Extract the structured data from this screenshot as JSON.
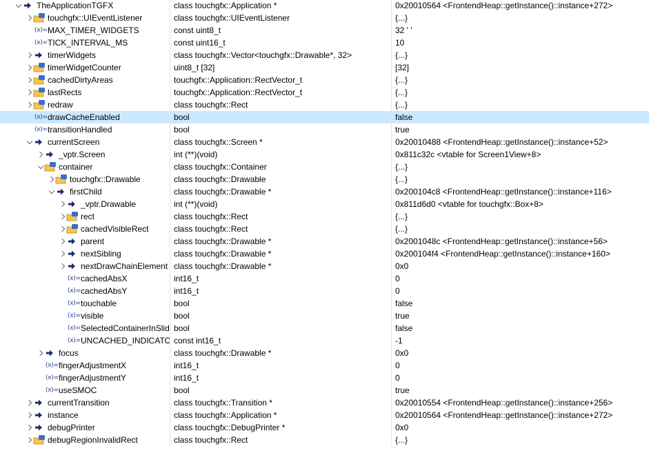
{
  "rows": [
    {
      "name": "TheApplicationTGFX",
      "type": "class touchgfx::Application *",
      "value": "0x20010564 <FrontendHeap::getInstance()::instance+272>",
      "level": 0,
      "toggle": "down",
      "icon": "arrow"
    },
    {
      "name": "touchgfx::UIEventListener",
      "type": "class touchgfx::UIEventListener",
      "value": "{...}",
      "level": 1,
      "toggle": "right",
      "icon": "folder"
    },
    {
      "name": "MAX_TIMER_WIDGETS",
      "type": "const uint8_t",
      "value": "32 ' '",
      "level": 1,
      "toggle": "none",
      "icon": "var"
    },
    {
      "name": "TICK_INTERVAL_MS",
      "type": "const uint16_t",
      "value": "10",
      "level": 1,
      "toggle": "none",
      "icon": "var"
    },
    {
      "name": "timerWidgets",
      "type": "class touchgfx::Vector<touchgfx::Drawable*, 32>",
      "value": "{...}",
      "level": 1,
      "toggle": "right",
      "icon": "arrow"
    },
    {
      "name": "timerWidgetCounter",
      "type": "uint8_t [32]",
      "value": "[32]",
      "level": 1,
      "toggle": "right",
      "icon": "folder"
    },
    {
      "name": "cachedDirtyAreas",
      "type": "touchgfx::Application::RectVector_t",
      "value": "{...}",
      "level": 1,
      "toggle": "right",
      "icon": "folder"
    },
    {
      "name": "lastRects",
      "type": "touchgfx::Application::RectVector_t",
      "value": "{...}",
      "level": 1,
      "toggle": "right",
      "icon": "folder"
    },
    {
      "name": "redraw",
      "type": "class touchgfx::Rect",
      "value": "{...}",
      "level": 1,
      "toggle": "right",
      "icon": "folder"
    },
    {
      "name": "drawCacheEnabled",
      "type": "bool",
      "value": "false",
      "level": 1,
      "toggle": "none",
      "icon": "var",
      "selected": true
    },
    {
      "name": "transitionHandled",
      "type": "bool",
      "value": "true",
      "level": 1,
      "toggle": "none",
      "icon": "var"
    },
    {
      "name": "currentScreen",
      "type": "class touchgfx::Screen *",
      "value": "0x20010488 <FrontendHeap::getInstance()::instance+52>",
      "level": 1,
      "toggle": "down",
      "icon": "arrow"
    },
    {
      "name": "_vptr.Screen",
      "type": "int (**)(void)",
      "value": "0x811c32c <vtable for Screen1View+8>",
      "level": 2,
      "toggle": "right",
      "icon": "arrow"
    },
    {
      "name": "container",
      "type": "class touchgfx::Container",
      "value": "{...}",
      "level": 2,
      "toggle": "down",
      "icon": "folder"
    },
    {
      "name": "touchgfx::Drawable",
      "type": "class touchgfx::Drawable",
      "value": "{...}",
      "level": 3,
      "toggle": "right",
      "icon": "folder"
    },
    {
      "name": "firstChild",
      "type": "class touchgfx::Drawable *",
      "value": "0x200104c8 <FrontendHeap::getInstance()::instance+116>",
      "level": 3,
      "toggle": "down",
      "icon": "arrow"
    },
    {
      "name": "_vptr.Drawable",
      "type": "int (**)(void)",
      "value": "0x811d6d0 <vtable for touchgfx::Box+8>",
      "level": 4,
      "toggle": "right",
      "icon": "arrow"
    },
    {
      "name": "rect",
      "type": "class touchgfx::Rect",
      "value": "{...}",
      "level": 4,
      "toggle": "right",
      "icon": "folder"
    },
    {
      "name": "cachedVisibleRect",
      "type": "class touchgfx::Rect",
      "value": "{...}",
      "level": 4,
      "toggle": "right",
      "icon": "folder"
    },
    {
      "name": "parent",
      "type": "class touchgfx::Drawable *",
      "value": "0x2001048c <FrontendHeap::getInstance()::instance+56>",
      "level": 4,
      "toggle": "right",
      "icon": "arrow"
    },
    {
      "name": "nextSibling",
      "type": "class touchgfx::Drawable *",
      "value": "0x200104f4 <FrontendHeap::getInstance()::instance+160>",
      "level": 4,
      "toggle": "right",
      "icon": "arrow"
    },
    {
      "name": "nextDrawChainElement",
      "type": "class touchgfx::Drawable *",
      "value": "0x0",
      "level": 4,
      "toggle": "right",
      "icon": "arrow"
    },
    {
      "name": "cachedAbsX",
      "type": "int16_t",
      "value": "0",
      "level": 4,
      "toggle": "none",
      "icon": "var"
    },
    {
      "name": "cachedAbsY",
      "type": "int16_t",
      "value": "0",
      "level": 4,
      "toggle": "none",
      "icon": "var"
    },
    {
      "name": "touchable",
      "type": "bool",
      "value": "false",
      "level": 4,
      "toggle": "none",
      "icon": "var"
    },
    {
      "name": "visible",
      "type": "bool",
      "value": "true",
      "level": 4,
      "toggle": "none",
      "icon": "var"
    },
    {
      "name": "SelectedContainerInSlider",
      "type": "bool",
      "value": "false",
      "level": 4,
      "toggle": "none",
      "icon": "var"
    },
    {
      "name": "UNCACHED_INDICATOR",
      "type": "const int16_t",
      "value": "-1",
      "level": 4,
      "toggle": "none",
      "icon": "var"
    },
    {
      "name": "focus",
      "type": "class touchgfx::Drawable *",
      "value": "0x0",
      "level": 2,
      "toggle": "right",
      "icon": "arrow"
    },
    {
      "name": "fingerAdjustmentX",
      "type": "int16_t",
      "value": "0",
      "level": 2,
      "toggle": "none",
      "icon": "var"
    },
    {
      "name": "fingerAdjustmentY",
      "type": "int16_t",
      "value": "0",
      "level": 2,
      "toggle": "none",
      "icon": "var"
    },
    {
      "name": "useSMOC",
      "type": "bool",
      "value": "true",
      "level": 2,
      "toggle": "none",
      "icon": "var"
    },
    {
      "name": "currentTransition",
      "type": "class touchgfx::Transition *",
      "value": "0x20010554 <FrontendHeap::getInstance()::instance+256>",
      "level": 1,
      "toggle": "right",
      "icon": "arrow"
    },
    {
      "name": "instance",
      "type": "class touchgfx::Application *",
      "value": "0x20010564 <FrontendHeap::getInstance()::instance+272>",
      "level": 1,
      "toggle": "right",
      "icon": "arrow"
    },
    {
      "name": "debugPrinter",
      "type": "class touchgfx::DebugPrinter *",
      "value": "0x0",
      "level": 1,
      "toggle": "right",
      "icon": "arrow"
    },
    {
      "name": "debugRegionInvalidRect",
      "type": "class touchgfx::Rect",
      "value": "{...}",
      "level": 1,
      "toggle": "right",
      "icon": "folder"
    }
  ],
  "icons": {
    "var": "(x)="
  },
  "colors": {
    "selected_row": "#cce8ff",
    "arrow_icon": "#1a2b6b",
    "folder_body": "#f5c451",
    "struct_badge": "#3a6fc4"
  }
}
